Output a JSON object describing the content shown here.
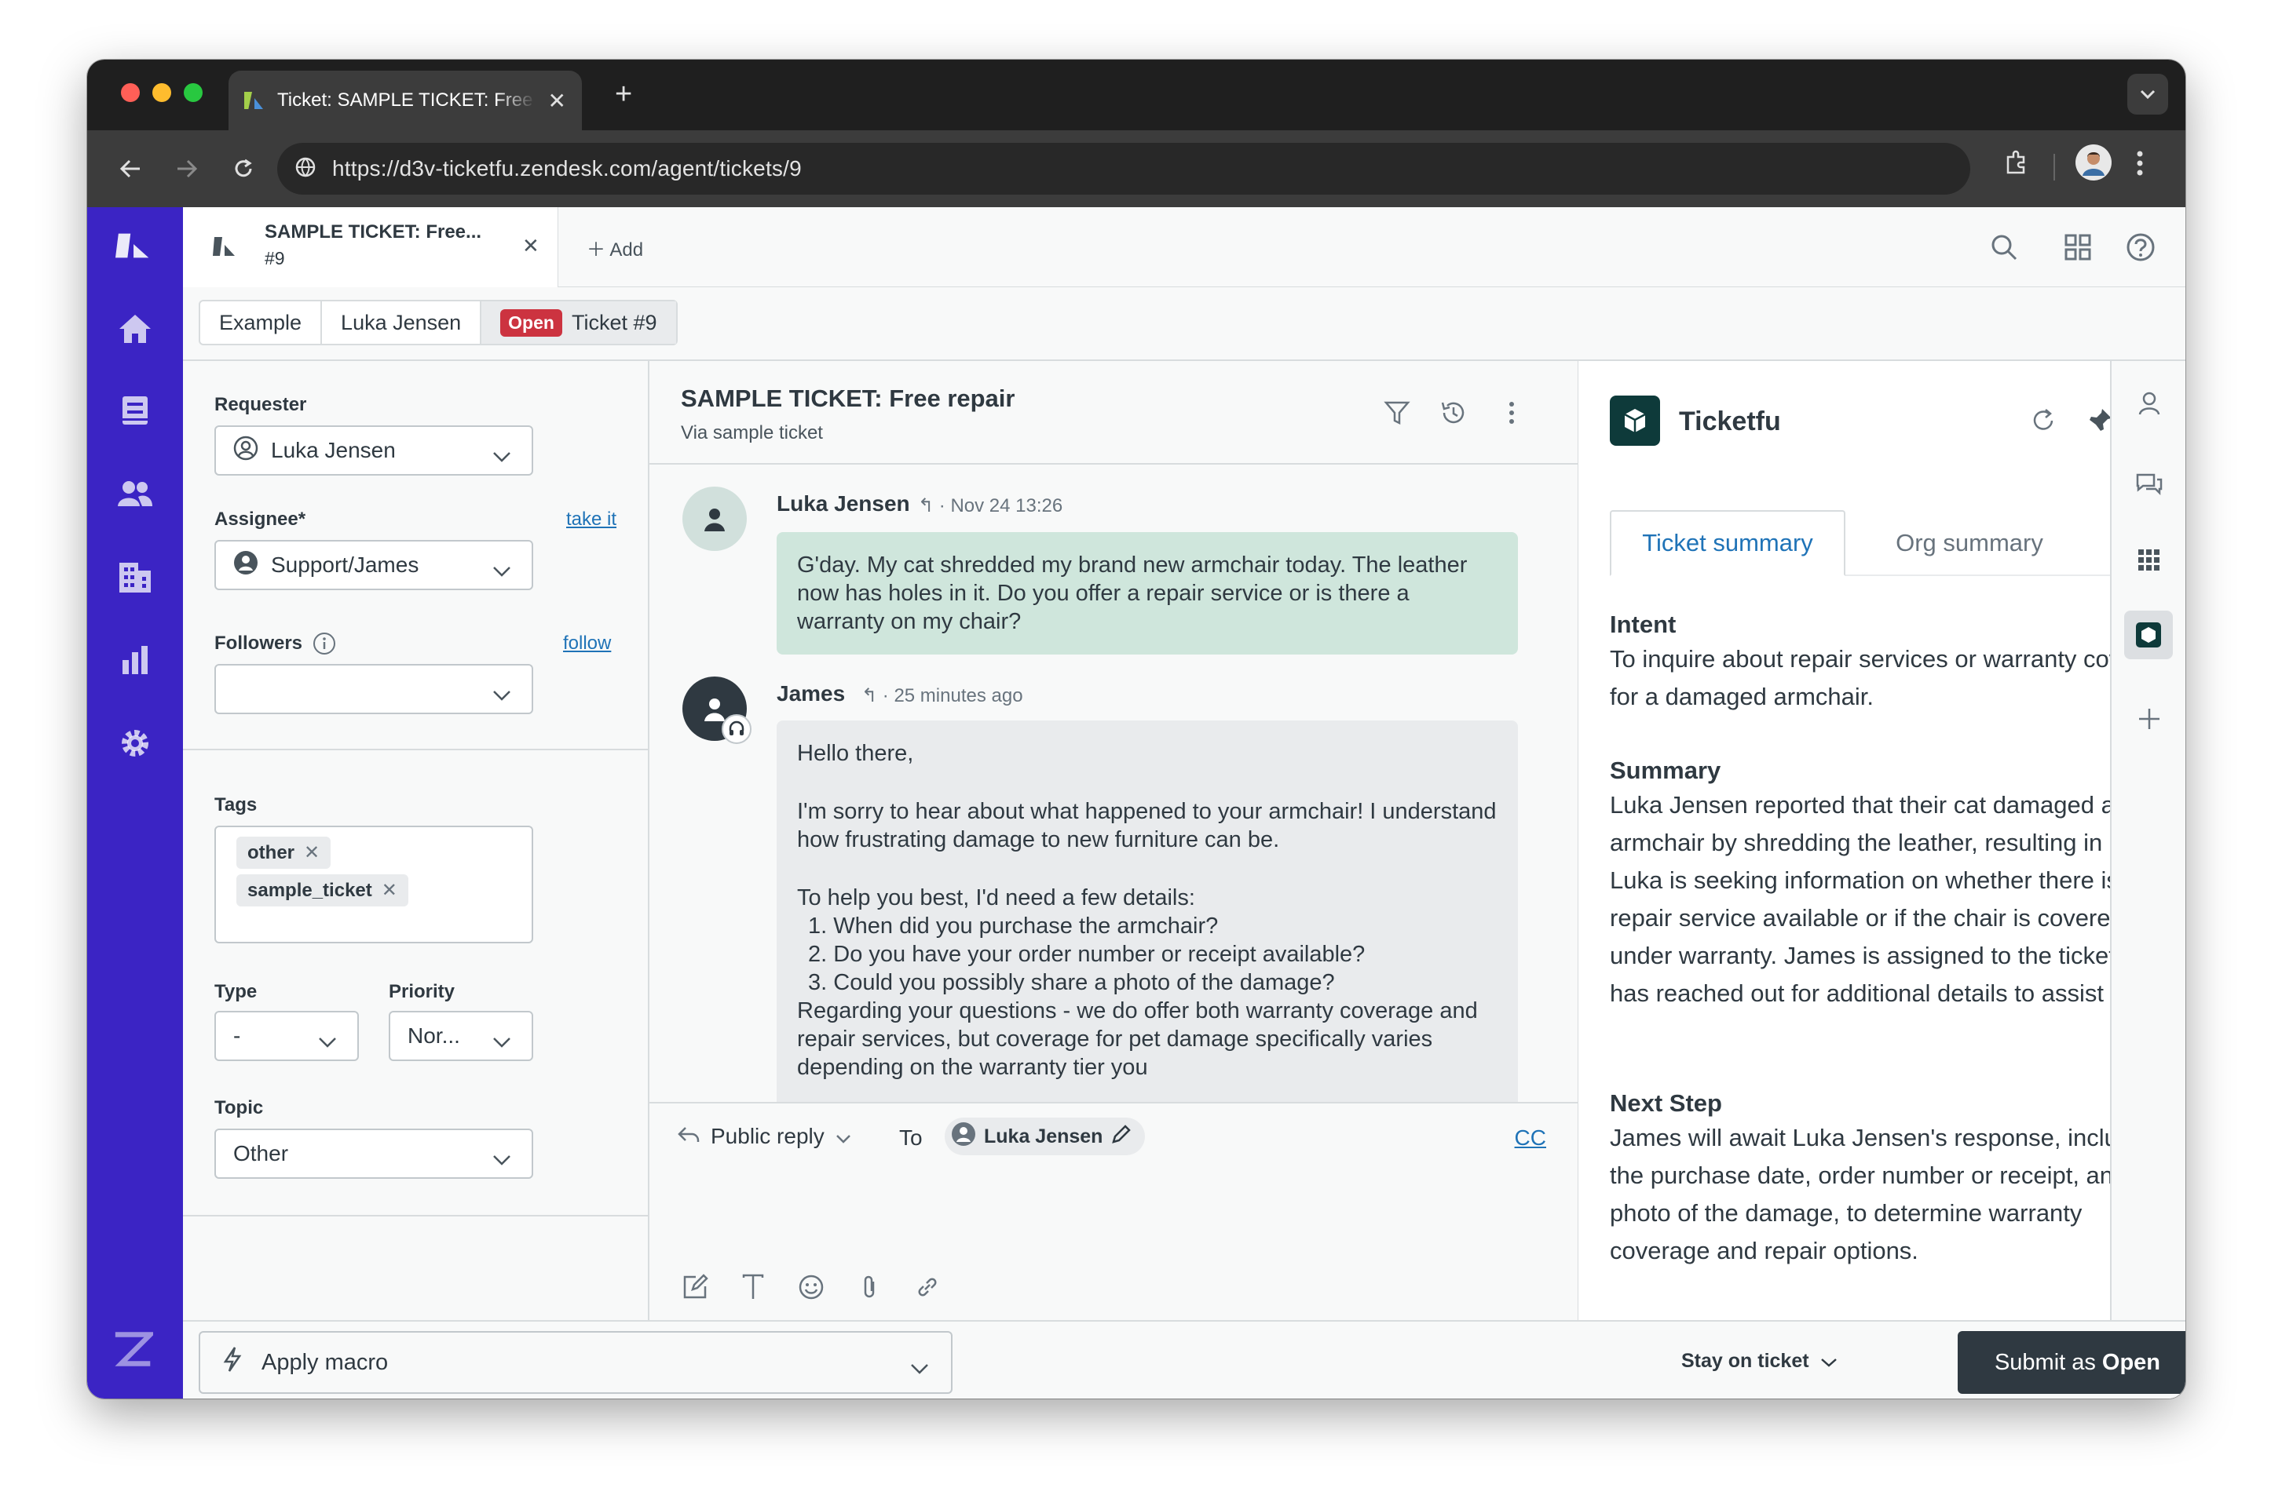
{
  "browser": {
    "tab_title": "Ticket: SAMPLE TICKET: Free repair",
    "url": "https://d3v-ticketfu.zendesk.com/agent/tickets/9"
  },
  "topbar": {
    "ticket_tab_title": "SAMPLE TICKET: Free...",
    "ticket_tab_number": "#9",
    "add_label": "Add"
  },
  "breadcrumbs": {
    "org": "Example",
    "requester": "Luka Jensen",
    "status": "Open",
    "ticket": "Ticket #9"
  },
  "properties": {
    "requester_label": "Requester",
    "requester_value": "Luka Jensen",
    "assignee_label": "Assignee*",
    "take_it": "take it",
    "assignee_value": "Support/James",
    "followers_label": "Followers",
    "follow": "follow",
    "tags_label": "Tags",
    "tags": [
      "other",
      "sample_ticket"
    ],
    "type_label": "Type",
    "type_value": "-",
    "priority_label": "Priority",
    "priority_value": "Nor...",
    "topic_label": "Topic",
    "topic_value": "Other"
  },
  "conversation": {
    "title": "SAMPLE TICKET: Free repair",
    "subtitle": "Via sample ticket",
    "messages": [
      {
        "author": "Luka Jensen",
        "time": "Nov 24 13:26",
        "body": "G'day. My cat shredded my brand new armchair today. The leather now has holes in it. Do you offer a repair service or is there a warranty on my chair?"
      },
      {
        "author": "James",
        "time": "25 minutes ago",
        "greeting": "Hello there,",
        "para1": "I'm sorry to hear about what happened to your armchair! I understand how frustrating damage to new furniture can be.",
        "para2": "To help you best, I'd need a few details:",
        "list": [
          "When did you purchase the armchair?",
          "Do you have your order number or receipt available?",
          "Could you possibly share a photo of the damage?"
        ],
        "para3": "Regarding your questions - we do offer both warranty coverage and repair services, but coverage for pet damage specifically varies depending on the warranty tier you"
      }
    ],
    "reply_type": "Public reply",
    "reply_to": "To",
    "recipient": "Luka Jensen",
    "cc": "CC"
  },
  "app": {
    "name": "Ticketfu",
    "tabs": [
      "Ticket summary",
      "Org summary"
    ],
    "sections": [
      {
        "heading": "Intent",
        "body": "To inquire about repair services or warranty coverage for a damaged armchair."
      },
      {
        "heading": "Summary",
        "body": "Luka Jensen reported that their cat damaged a new armchair by shredding the leather, resulting in holes. Luka is seeking information on whether there is a repair service available or if the chair is covered under warranty. James is assigned to the ticket and has reached out for additional details to assist Luka."
      },
      {
        "heading": "Next Step",
        "body": "James will await Luka Jensen's response, including the purchase date, order number or receipt, and a photo of the damage, to determine warranty coverage and repair options."
      }
    ]
  },
  "footer": {
    "macro_label": "Apply macro",
    "stay_label": "Stay on ticket",
    "submit_prefix": "Submit as",
    "submit_status": "Open"
  },
  "colors": {
    "nav_bg": "#3b24c4",
    "open_badge": "#cc3340",
    "link": "#1f73b7",
    "customer_bubble": "#cfe6dc",
    "app_logo": "#0e3a3a"
  }
}
